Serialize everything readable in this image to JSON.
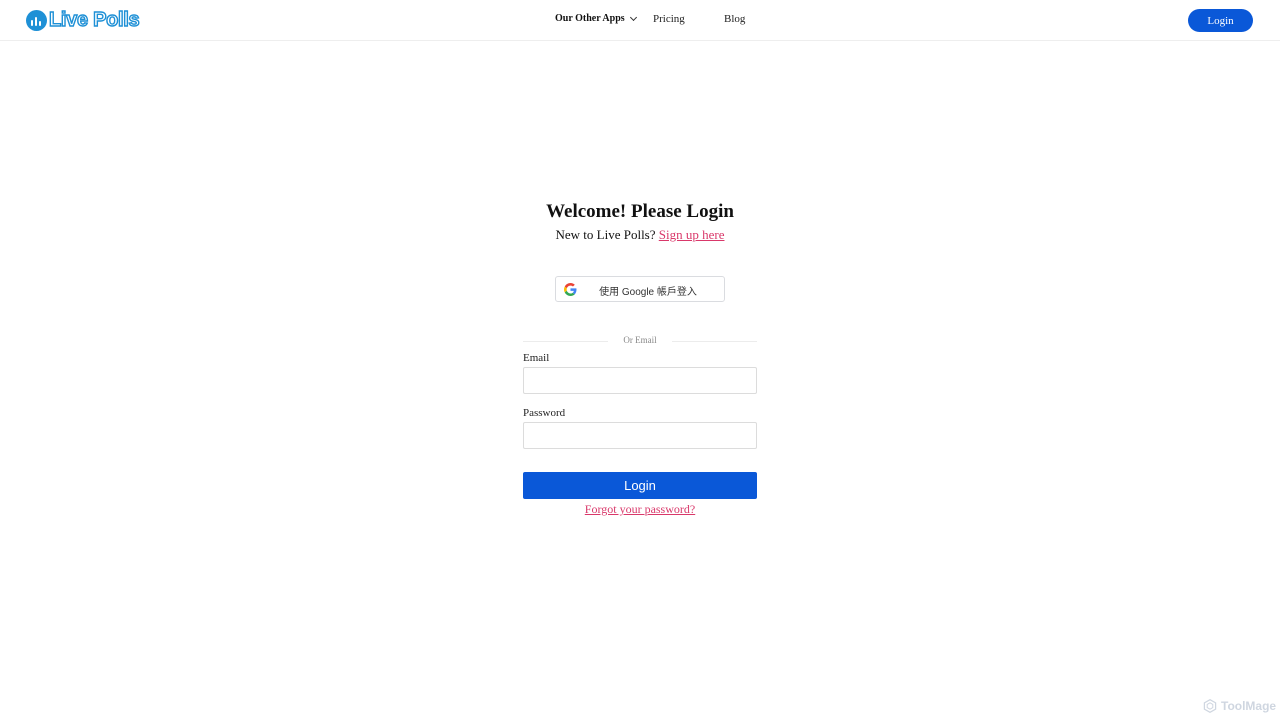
{
  "header": {
    "logo_text": "Live Polls",
    "nav": {
      "apps_label": "Our Other Apps",
      "pricing_label": "Pricing",
      "blog_label": "Blog"
    },
    "login_button": "Login"
  },
  "main": {
    "title": "Welcome! Please Login",
    "subtitle_prefix": "New to Live Polls?",
    "signup_link": "Sign up here",
    "google_button": "使用 Google 帳戶登入",
    "divider_text": "Or Email",
    "email_label": "Email",
    "email_value": "",
    "password_label": "Password",
    "password_value": "",
    "submit_button": "Login",
    "forgot_link": "Forgot your password?"
  },
  "watermark": "ToolMage",
  "colors": {
    "primary": "#0a58d8",
    "link": "#d9386a",
    "logo": "#1e90d6"
  },
  "icons": [
    "logo-icon",
    "chevron-down-icon",
    "google-icon",
    "toolmage-logo-icon"
  ]
}
